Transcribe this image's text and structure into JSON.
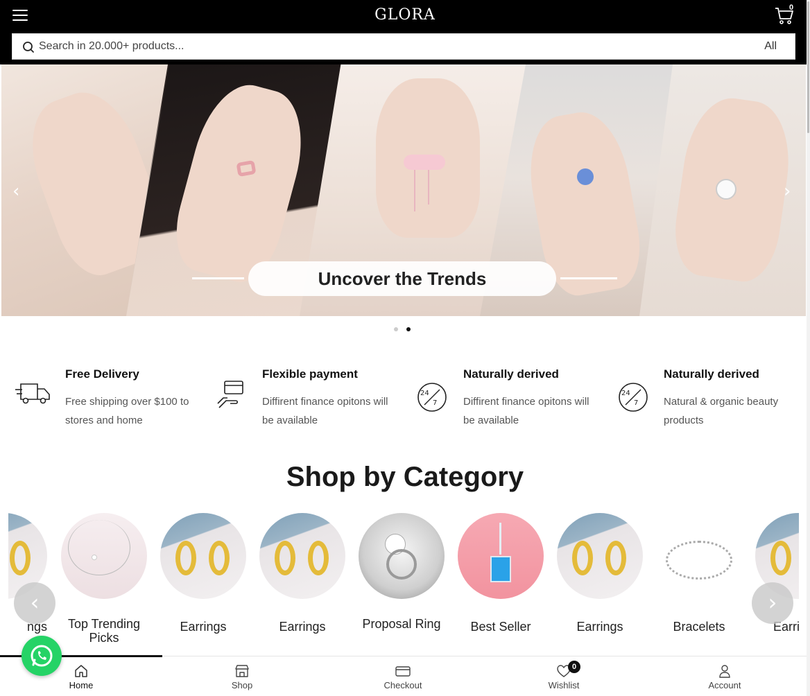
{
  "header": {
    "logo": "GLORA",
    "cart_count": "0",
    "search_placeholder": "Search in 20.000+ products...",
    "search_category": "All"
  },
  "hero": {
    "caption": "Uncover the Trends",
    "slides": 2,
    "active_slide": 2
  },
  "features": [
    {
      "title": "Free Delivery",
      "desc": "Free shipping over $100 to stores and home",
      "icon": "delivery-truck-icon"
    },
    {
      "title": "Flexible payment",
      "desc": "Diffirent finance opitons will be available",
      "icon": "payment-hand-icon"
    },
    {
      "title": "Naturally derived",
      "desc": "Diffirent finance opitons will be available",
      "icon": "support-24-7-icon"
    },
    {
      "title": "Naturally derived",
      "desc": "Natural & organic beauty products",
      "icon": "support-24-7-icon"
    }
  ],
  "category": {
    "title": "Shop by Category",
    "items": [
      {
        "label": "ngs",
        "image": "earrings"
      },
      {
        "label": "Top Trending Picks",
        "image": "necklace"
      },
      {
        "label": "Earrings",
        "image": "earrings"
      },
      {
        "label": "Earrings",
        "image": "earrings"
      },
      {
        "label": "Proposal Ring",
        "image": "ring"
      },
      {
        "label": "Best Seller",
        "image": "pendant"
      },
      {
        "label": "Earrings",
        "image": "earrings"
      },
      {
        "label": "Bracelets",
        "image": "bracelet"
      },
      {
        "label": "Earri",
        "image": "earrings"
      }
    ]
  },
  "bottom_nav": {
    "items": [
      {
        "label": "Home",
        "icon": "home-icon"
      },
      {
        "label": "Shop",
        "icon": "store-icon"
      },
      {
        "label": "Checkout",
        "icon": "credit-card-icon"
      },
      {
        "label": "Wishlist",
        "icon": "heart-icon"
      },
      {
        "label": "Account",
        "icon": "user-icon"
      }
    ],
    "wishlist_count": "0",
    "active": "Home"
  },
  "colors": {
    "header_bg": "#000000",
    "whatsapp": "#25D366",
    "earring_gold": "#E4BB3A"
  }
}
